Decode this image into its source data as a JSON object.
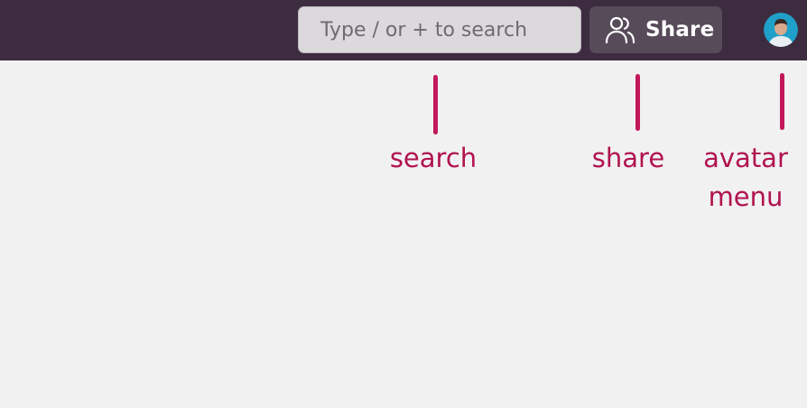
{
  "topbar": {
    "search": {
      "placeholder": "Type / or + to search"
    },
    "share": {
      "label": "Share",
      "icon": "users-icon"
    },
    "avatar": {
      "icon": "user-avatar"
    }
  },
  "annotations": {
    "search": "search",
    "share": "share",
    "avatar_line1": "avatar",
    "avatar_line2": "menu"
  },
  "colors": {
    "topbar_bg": "#3d2b3f",
    "accent": "#c2185b",
    "annotation_text": "#b0144f",
    "page_bg": "#f2f1f1"
  }
}
